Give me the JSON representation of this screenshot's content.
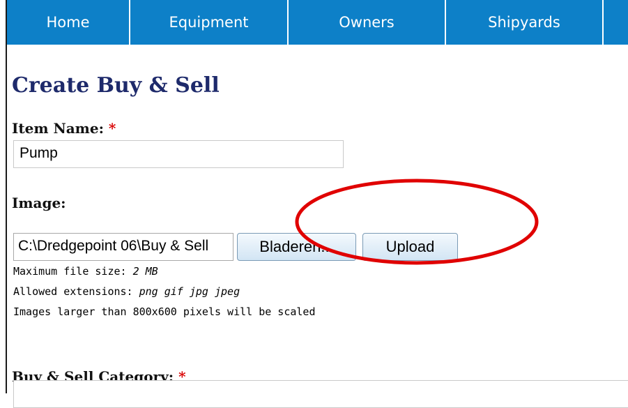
{
  "nav": {
    "items": [
      {
        "label": "Home"
      },
      {
        "label": "Equipment"
      },
      {
        "label": "Owners"
      },
      {
        "label": "Shipyards"
      },
      {
        "label": ""
      }
    ]
  },
  "page": {
    "title": "Create Buy & Sell"
  },
  "form": {
    "item_name": {
      "label": "Item Name:",
      "required_mark": "*",
      "value": "Pump"
    },
    "image": {
      "label": "Image:",
      "file_path": "C:\\Dredgepoint 06\\Buy & Sell",
      "browse_label": "Bladeren...",
      "upload_label": "Upload",
      "help": {
        "max_size_prefix": "Maximum file size: ",
        "max_size_value": "2 MB",
        "ext_prefix": "Allowed extensions: ",
        "ext_value": "png gif jpg jpeg",
        "scale_note": "Images larger than 800x600 pixels will be scaled"
      }
    },
    "category": {
      "label": "Buy & Sell Category:",
      "required_mark": "*",
      "value": ""
    }
  },
  "colors": {
    "nav_bg": "#0d80c8",
    "title": "#1e2a6b",
    "required": "#d90000",
    "annotation": "#e00000"
  }
}
